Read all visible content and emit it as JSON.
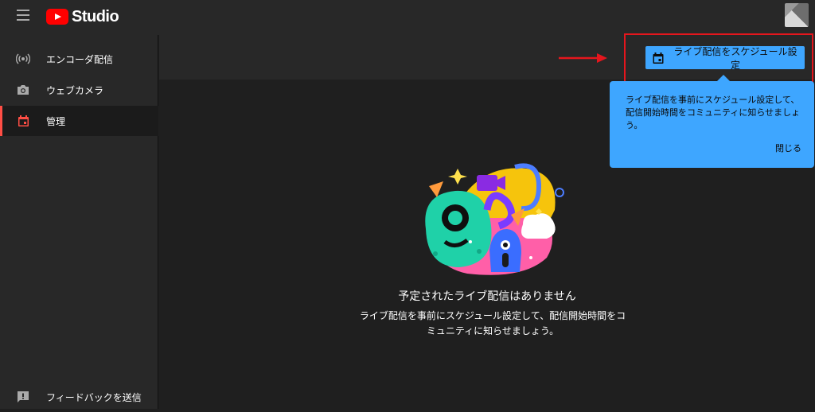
{
  "app": {
    "logo_text": "Studio",
    "brand_color": "#ff0000",
    "accent_color": "#3ea6ff"
  },
  "sidebar": {
    "items": [
      {
        "label": "エンコーダ配信",
        "icon": "broadcast-icon"
      },
      {
        "label": "ウェブカメラ",
        "icon": "camera-icon"
      },
      {
        "label": "管理",
        "icon": "calendar-icon",
        "active": true
      }
    ],
    "feedback": {
      "label": "フィードバックを送信",
      "icon": "feedback-icon"
    }
  },
  "toolbar": {
    "schedule_label": "ライブ配信をスケジュール設定"
  },
  "tooltip": {
    "text": "ライブ配信を事前にスケジュール設定して、配信開始時間をコミュニティに知らせましょう。",
    "close_label": "閉じる"
  },
  "empty_state": {
    "title": "予定されたライブ配信はありません",
    "description": "ライブ配信を事前にスケジュール設定して、配信開始時間をコミュニティに知らせましょう。"
  }
}
